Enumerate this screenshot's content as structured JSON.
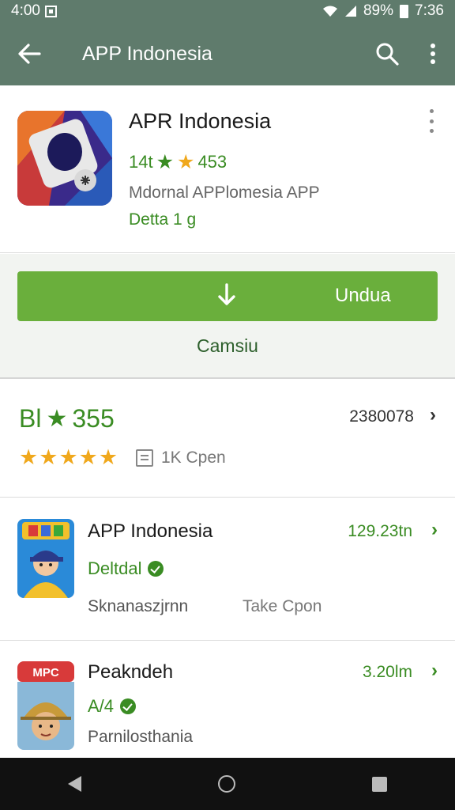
{
  "status": {
    "time_left": "4:00",
    "battery": "89%",
    "time_right": "7:36"
  },
  "toolbar": {
    "title": "APP Indonesia",
    "back_icon": "arrow-left-icon",
    "search_icon": "search-icon",
    "more_icon": "more-vertical-icon"
  },
  "app": {
    "name": "APR Indonesia",
    "rating_left": "14t",
    "rating_right": "453",
    "developer": "Mdornal APPlomesia APP",
    "badge": "Detta 1 g"
  },
  "install": {
    "button_label": "Undua",
    "cancel_label": "Camsiu"
  },
  "rating": {
    "label": "Bl",
    "value": "355",
    "count": "2380078",
    "open_note": "1K Cpen",
    "stars": [
      "★",
      "★",
      "★",
      "★",
      "★"
    ]
  },
  "list": [
    {
      "name": "APP Indonesia",
      "size": "129.23tn",
      "badge": "Deltdal",
      "meta": "Sknanaszjrnn",
      "meta2": "Take Cpon",
      "icon": "game-avatar-icon"
    },
    {
      "name": "Peakndeh",
      "size": "3.20lm",
      "badge": "A/4",
      "meta": "Parnilosthania",
      "icon": "game-avatar-hat-icon",
      "icon_text": "MPC"
    }
  ],
  "colors": {
    "toolbar": "#5f7b6c",
    "accent_green": "#3a8c23",
    "install_green": "#6aaf3c",
    "star_orange": "#f0a81c"
  }
}
